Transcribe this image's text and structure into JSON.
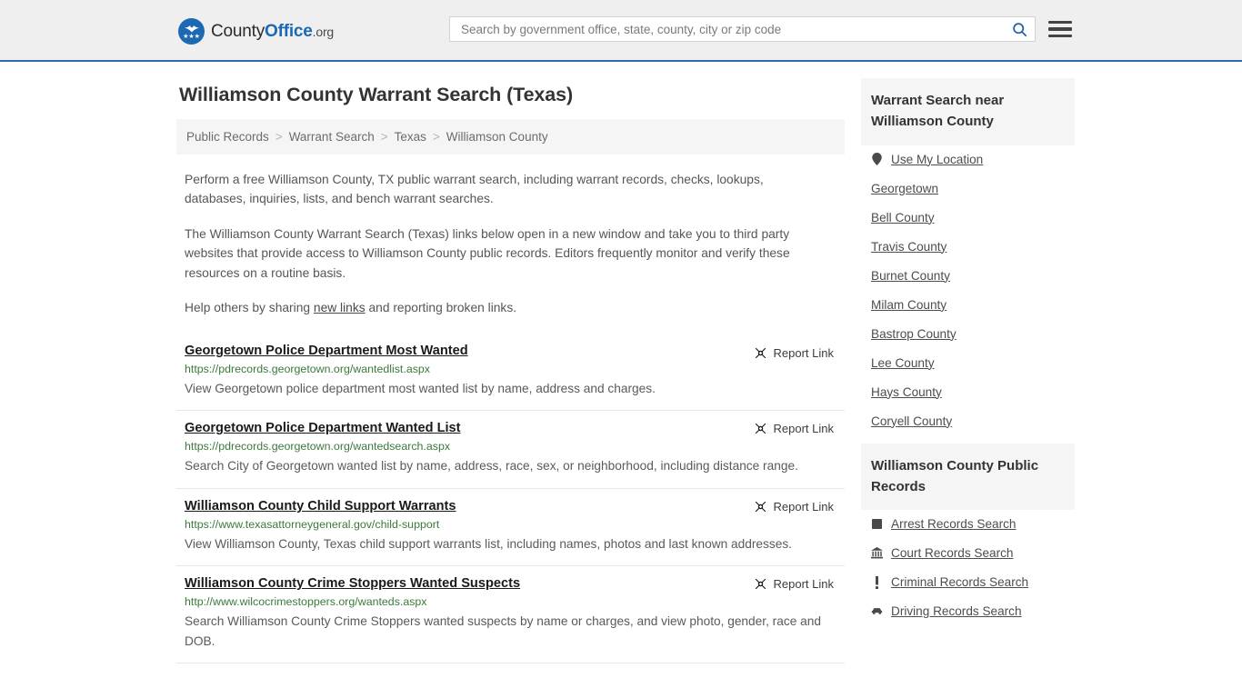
{
  "header": {
    "logo": {
      "text_part1": "County",
      "text_part2": "Office",
      "text_part3": ".org"
    },
    "search": {
      "placeholder": "Search by government office, state, county, city or zip code",
      "value": ""
    }
  },
  "page": {
    "title": "Williamson County Warrant Search (Texas)"
  },
  "breadcrumb": {
    "items": [
      {
        "label": "Public Records"
      },
      {
        "label": "Warrant Search"
      },
      {
        "label": "Texas"
      },
      {
        "label": "Williamson County"
      }
    ],
    "separator": ">"
  },
  "intro": {
    "p1": "Perform a free Williamson County, TX public warrant search, including warrant records, checks, lookups, databases, inquiries, lists, and bench warrant searches.",
    "p2": "The Williamson County Warrant Search (Texas) links below open in a new window and take you to third party websites that provide access to Williamson County public records. Editors frequently monitor and verify these resources on a routine basis.",
    "p3_before": "Help others by sharing ",
    "p3_link": "new links",
    "p3_after": " and reporting broken links."
  },
  "results": {
    "report_label": "Report Link",
    "items": [
      {
        "title": "Georgetown Police Department Most Wanted",
        "url": "https://pdrecords.georgetown.org/wantedlist.aspx",
        "description": "View Georgetown police department most wanted list by name, address and charges."
      },
      {
        "title": "Georgetown Police Department Wanted List",
        "url": "https://pdrecords.georgetown.org/wantedsearch.aspx",
        "description": "Search City of Georgetown wanted list by name, address, race, sex, or neighborhood, including distance range."
      },
      {
        "title": "Williamson County Child Support Warrants",
        "url": "https://www.texasattorneygeneral.gov/child-support",
        "description": "View Williamson County, Texas child support warrants list, including names, photos and last known addresses."
      },
      {
        "title": "Williamson County Crime Stoppers Wanted Suspects",
        "url": "http://www.wilcocrimestoppers.org/wanteds.aspx",
        "description": "Search Williamson County Crime Stoppers wanted suspects by name or charges, and view photo, gender, race and DOB."
      }
    ]
  },
  "sidebar": {
    "nearby": {
      "heading": "Warrant Search near Williamson County",
      "items": [
        {
          "label": "Use My Location",
          "icon": "map-pin-icon"
        },
        {
          "label": "Georgetown",
          "icon": ""
        },
        {
          "label": "Bell County",
          "icon": ""
        },
        {
          "label": "Travis County",
          "icon": ""
        },
        {
          "label": "Burnet County",
          "icon": ""
        },
        {
          "label": "Milam County",
          "icon": ""
        },
        {
          "label": "Bastrop County",
          "icon": ""
        },
        {
          "label": "Lee County",
          "icon": ""
        },
        {
          "label": "Hays County",
          "icon": ""
        },
        {
          "label": "Coryell County",
          "icon": ""
        }
      ]
    },
    "public_records": {
      "heading": "Williamson County Public Records",
      "items": [
        {
          "label": "Arrest Records Search",
          "icon": "fingerprint-icon"
        },
        {
          "label": "Court Records Search",
          "icon": "courthouse-icon"
        },
        {
          "label": "Criminal Records Search",
          "icon": "exclamation-icon"
        },
        {
          "label": "Driving Records Search",
          "icon": "car-icon"
        }
      ]
    }
  },
  "colors": {
    "accent_blue": "#1d68b3",
    "header_bg": "#efefef",
    "url_green": "#3c7a3c",
    "panel_bg": "#f5f5f5"
  }
}
